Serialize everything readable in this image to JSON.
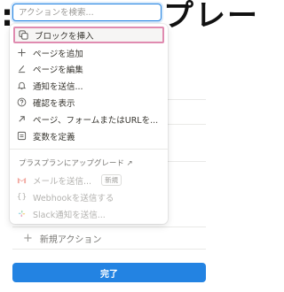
{
  "search": {
    "placeholder": "アクションを検索..."
  },
  "background": {
    "title_fragment": "プレー",
    "new_action_label": "新規アクション",
    "done_label": "完了"
  },
  "menu": {
    "items": [
      {
        "label": "ブロックを挿入",
        "icon": "copy-block-icon",
        "highlighted": true
      },
      {
        "label": "ページを追加",
        "icon": "plus-icon"
      },
      {
        "label": "ページを編集",
        "icon": "edit-icon"
      },
      {
        "label": "通知を送信...",
        "icon": "bell-icon"
      },
      {
        "label": "確認を表示",
        "icon": "question-icon"
      },
      {
        "label": "ページ、フォームまたはURLを...",
        "icon": "arrow-up-right-icon"
      },
      {
        "label": "変数を定義",
        "icon": "variable-icon"
      }
    ],
    "upgrade_label": "プラスプランにアップグレード ↗",
    "plus_items": [
      {
        "label": "メールを送信...",
        "icon": "gmail-icon",
        "badge": "新規"
      },
      {
        "label": "Webhookを送信する",
        "icon": "braces-icon"
      },
      {
        "label": "Slack通知を送信...",
        "icon": "slack-icon"
      }
    ]
  },
  "colors": {
    "accent": "#2383e2",
    "highlight_border": "#e08bb0",
    "gmail": "#ea4335"
  }
}
